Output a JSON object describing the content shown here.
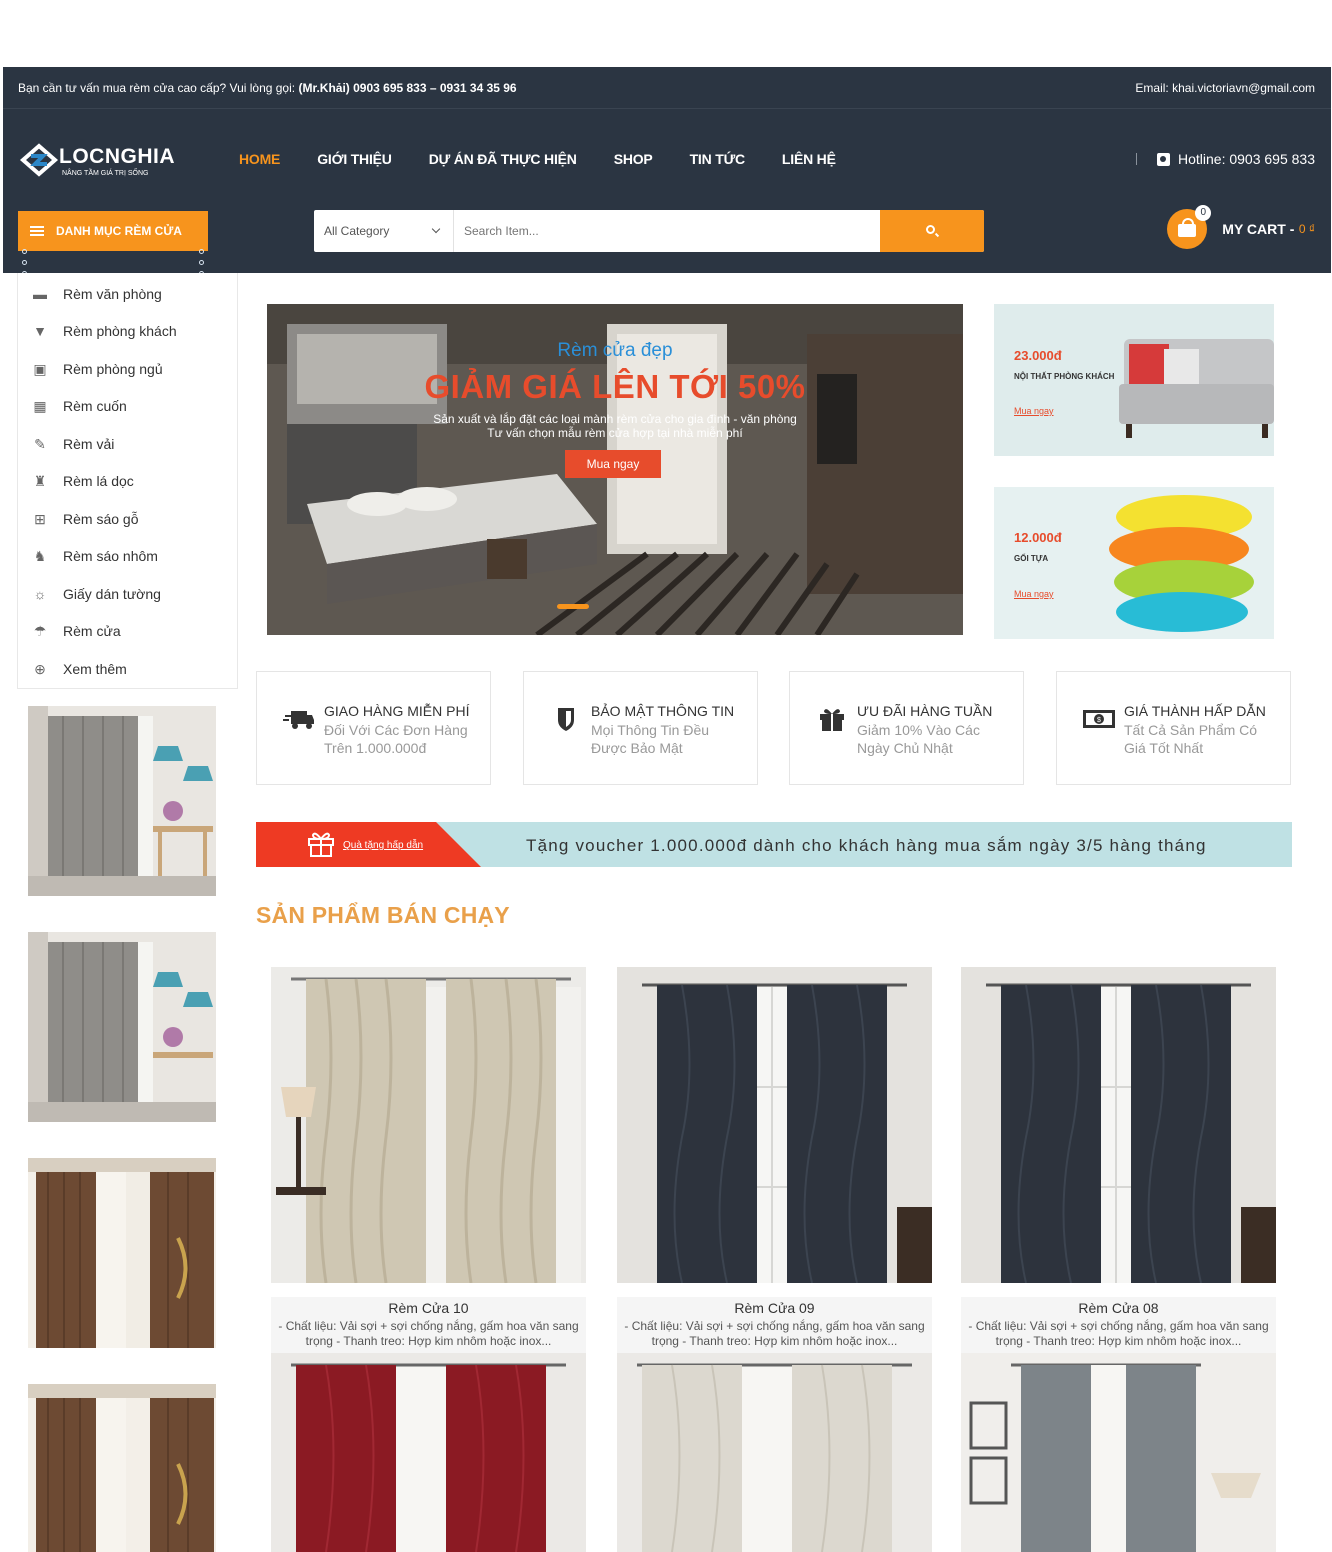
{
  "topbar": {
    "consult": "Bạn cần tư vấn mua rèm cửa cao cấp? Vui lòng gọi:",
    "contact": "(Mr.Khải) 0903 695 833 – 0931 34 35 96",
    "email": "Email: khai.victoriavn@gmail.com"
  },
  "logo": {
    "name": "LOCNGHIA",
    "tagline": "NÂNG TẦM GIÁ TRỊ SỐNG"
  },
  "nav": [
    "HOME",
    "GIỚI THIỆU",
    "DỰ ÁN ĐÃ THỰC HIỆN",
    "SHOP",
    "TIN TỨC",
    "LIÊN HỆ"
  ],
  "hotline": "Hotline: 0903 695 833",
  "category_button": "DANH MỤC RÈM CỬA",
  "search": {
    "category": "All Category",
    "placeholder": "Search Item..."
  },
  "cart": {
    "label": "MY CART -",
    "amount": "0 ₫",
    "count": "0"
  },
  "sidebar": {
    "items": [
      {
        "label": "Rèm văn phòng",
        "icon": "briefcase-icon",
        "glyph": "▬"
      },
      {
        "label": "Rèm phòng khách",
        "icon": "lamp-icon",
        "glyph": "▼"
      },
      {
        "label": "Rèm phòng ngủ",
        "icon": "camera-icon",
        "glyph": "▣"
      },
      {
        "label": "Rèm cuốn",
        "icon": "gift-icon",
        "glyph": "▦"
      },
      {
        "label": "Rèm vải",
        "icon": "brush-icon",
        "glyph": "✎"
      },
      {
        "label": "Rèm lá dọc",
        "icon": "dress-icon",
        "glyph": "♜"
      },
      {
        "label": "Rèm sáo gỗ",
        "icon": "fence-icon",
        "glyph": "⊞"
      },
      {
        "label": "Rèm sáo nhôm",
        "icon": "stroller-icon",
        "glyph": "♞"
      },
      {
        "label": "Giấy dán tường",
        "icon": "sun-icon",
        "glyph": "☼"
      },
      {
        "label": "Rèm cửa",
        "icon": "umbrella-icon",
        "glyph": "☂"
      },
      {
        "label": "Xem thêm",
        "icon": "plus-circle-icon",
        "glyph": "⊕"
      }
    ]
  },
  "hero": {
    "subtitle": "Rèm cửa đẹp",
    "title": "GIẢM GIÁ LÊN TỚI 50%",
    "desc1": "Sản xuất và lắp đặt các loại mành rèm cửa cho gia đình - văn phòng",
    "desc2": "Tư vấn chọn mẫu rèm cửa hợp tại nhà miễn phí",
    "button": "Mua ngay"
  },
  "promos": [
    {
      "price": "23.000đ",
      "sub": "NỘI THẤT PHÒNG KHÁCH",
      "link": "Mua ngay"
    },
    {
      "price": "12.000đ",
      "sub": "GỐI TỰA",
      "link": "Mua ngay"
    }
  ],
  "features": [
    {
      "title": "GIAO HÀNG MIỄN PHÍ",
      "l1": "Đối Với Các Đơn Hàng",
      "l2": "Trên 1.000.000đ",
      "icon": "truck-icon"
    },
    {
      "title": "BẢO MẬT THÔNG TIN",
      "l1": "Mọi Thông Tin Đều",
      "l2": "Được Bảo Mật",
      "icon": "shield-icon"
    },
    {
      "title": "ƯU ĐÃI HÀNG TUẦN",
      "l1": "Giảm 10% Vào Các",
      "l2": "Ngày Chủ Nhật",
      "icon": "gift-icon"
    },
    {
      "title": "GIÁ THÀNH HẤP DẪN",
      "l1": "Tất Cả Sản Phẩm Có",
      "l2": "Giá Tốt Nhất",
      "icon": "money-icon"
    }
  ],
  "voucher": {
    "tag": "Quà tặng hấp dẫn",
    "message": "Tặng voucher 1.000.000đ dành cho khách hàng mua sắm ngày 3/5 hàng tháng"
  },
  "section_title": "SẢN PHẨM BÁN CHẠY",
  "products": [
    {
      "name": "Rèm Cửa 10",
      "desc": "- Chất liệu: Vải sợi + sợi chống nắng, gấm hoa văn sang trọng - Thanh treo: Hợp kim nhôm hoặc inox...",
      "color": "#cfc7b3"
    },
    {
      "name": "Rèm Cửa 09",
      "desc": "- Chất liệu: Vải sợi + sợi chống nắng, gấm hoa văn sang trọng - Thanh treo: Hợp kim nhôm hoặc inox...",
      "color": "#2d333d"
    },
    {
      "name": "Rèm Cửa 08",
      "desc": "- Chất liệu: Vải sợi + sợi chống nắng, gấm hoa văn sang trọng - Thanh treo: Hợp kim nhôm hoặc inox...",
      "color": "#2d333d"
    }
  ],
  "colors": {
    "header": "#2b3542",
    "accent": "#f7941d",
    "red": "#e74c2c"
  }
}
